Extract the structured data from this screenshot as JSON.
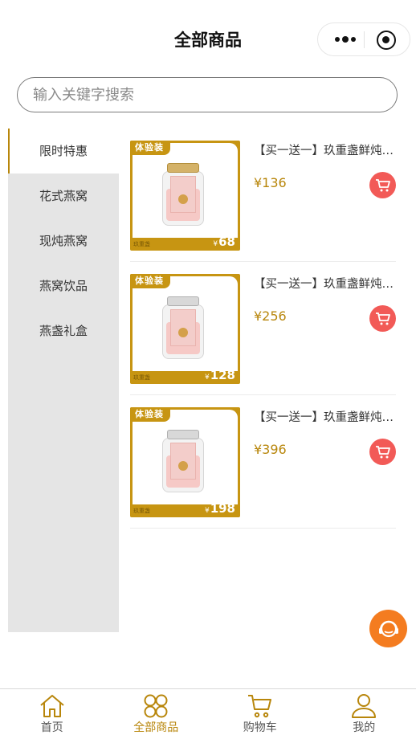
{
  "header": {
    "title": "全部商品"
  },
  "search": {
    "placeholder": "输入关键字搜索"
  },
  "sidebar": {
    "items": [
      {
        "label": "限时特惠",
        "active": true
      },
      {
        "label": "花式燕窝"
      },
      {
        "label": "现炖燕窝"
      },
      {
        "label": "燕窝饮品"
      },
      {
        "label": "燕盏礼盒"
      }
    ]
  },
  "products": [
    {
      "name": "【买一送一】玖重盏鲜炖燕窝",
      "price": "¥136",
      "badge": "体验装",
      "badge_price": "68",
      "currency": "¥",
      "brand": "玖重盏",
      "lid": "gold"
    },
    {
      "name": "【买一送一】玖重盏鲜炖燕窝",
      "price": "¥256",
      "badge": "体验装",
      "badge_price": "128",
      "currency": "¥",
      "brand": "玖重盏",
      "lid": "silver"
    },
    {
      "name": "【买一送一】玖重盏鲜炖燕窝",
      "price": "¥396",
      "badge": "体验装",
      "badge_price": "198",
      "currency": "¥",
      "brand": "玖重盏",
      "lid": "silver"
    }
  ],
  "tabbar": {
    "items": [
      {
        "label": "首页",
        "icon": "home-icon"
      },
      {
        "label": "全部商品",
        "icon": "category-icon",
        "active": true
      },
      {
        "label": "购物车",
        "icon": "cart-icon"
      },
      {
        "label": "我的",
        "icon": "user-icon"
      }
    ]
  },
  "colors": {
    "accent": "#b8860b",
    "cart": "#f25a57",
    "service": "#f47c20",
    "sidebar_bg": "#e5e5e5"
  }
}
